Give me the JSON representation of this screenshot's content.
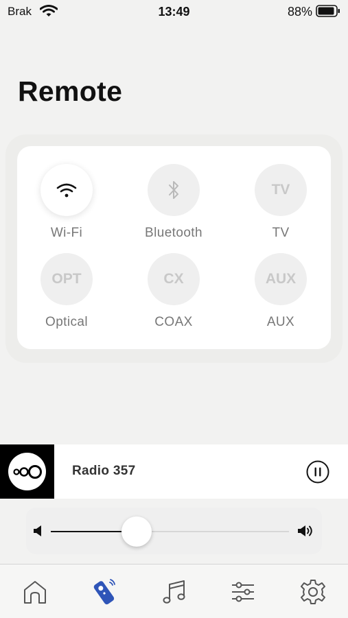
{
  "status_bar": {
    "carrier": "Brak",
    "time": "13:49",
    "battery_percent": "88%"
  },
  "page": {
    "title": "Remote"
  },
  "sources": [
    {
      "id": "wifi",
      "icon": "wifi-icon",
      "glyph": "",
      "label": "Wi-Fi",
      "selected": true
    },
    {
      "id": "bluetooth",
      "icon": "bluetooth-icon",
      "glyph": "",
      "label": "Bluetooth",
      "selected": false
    },
    {
      "id": "tv",
      "icon": "",
      "glyph": "TV",
      "label": "TV",
      "selected": false
    },
    {
      "id": "optical",
      "icon": "",
      "glyph": "OPT",
      "label": "Optical",
      "selected": false
    },
    {
      "id": "coax",
      "icon": "",
      "glyph": "CX",
      "label": "COAX",
      "selected": false
    },
    {
      "id": "aux",
      "icon": "",
      "glyph": "AUX",
      "label": "AUX",
      "selected": false
    }
  ],
  "now_playing": {
    "title": "Radio 357",
    "state": "playing"
  },
  "volume": {
    "level_fraction": 0.36
  },
  "tabs": [
    {
      "id": "home",
      "icon": "home-icon",
      "active": false
    },
    {
      "id": "remote",
      "icon": "remote-icon",
      "active": true
    },
    {
      "id": "music",
      "icon": "music-note-icon",
      "active": false
    },
    {
      "id": "equalizer",
      "icon": "sliders-icon",
      "active": false
    },
    {
      "id": "settings",
      "icon": "gear-icon",
      "active": false
    }
  ],
  "colors": {
    "accent": "#2f55b8",
    "panel": "#ffffff",
    "background": "#f2f2f1",
    "muted_text": "#777777"
  }
}
